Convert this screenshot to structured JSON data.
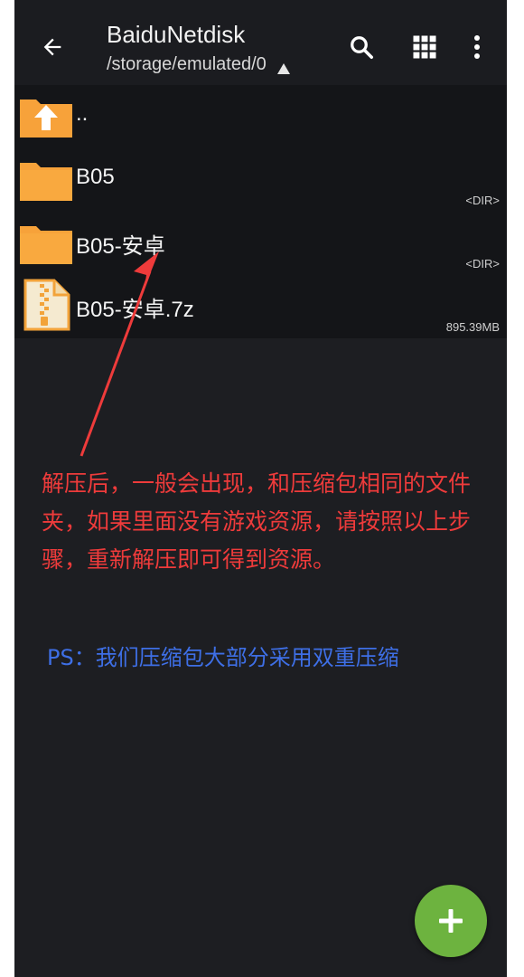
{
  "toolbar": {
    "title": "BaiduNetdisk",
    "path": "/storage/emulated/0",
    "icons": {
      "back": "arrow-left-icon",
      "search": "search-icon",
      "grid": "grid-view-icon",
      "more": "more-vert-icon",
      "path_dropdown": "triangle-icon"
    }
  },
  "files": [
    {
      "name": "..",
      "meta": "",
      "icon": "folder-up-icon"
    },
    {
      "name": "B05",
      "meta": "<DIR>",
      "icon": "folder-icon"
    },
    {
      "name": "B05-安卓",
      "meta": "<DIR>",
      "icon": "folder-icon"
    },
    {
      "name": "B05-安卓.7z",
      "meta": "895.39MB",
      "icon": "archive-file-icon"
    }
  ],
  "annotation": {
    "red_text": "解压后，一般会出现，和压缩包相同的文件夹，如果里面没有游戏资源，请按照以上步骤，重新解压即可得到资源。",
    "blue_text": "PS：我们压缩包大部分采用双重压缩",
    "red_color": "#ee3b3b",
    "blue_color": "#3e6fe6"
  },
  "colors": {
    "folder": "#f7a23a",
    "fab": "#6db33f",
    "background": "#1d1e22",
    "list_background": "#141518"
  },
  "fab": {
    "icon": "plus-icon"
  }
}
